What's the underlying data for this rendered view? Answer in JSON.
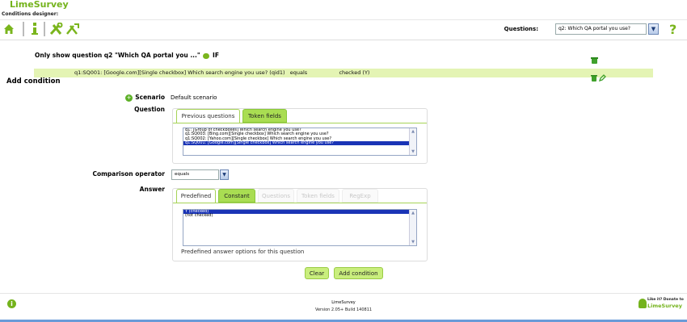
{
  "app": {
    "brand": "LimeSurvey",
    "designer_title": "Conditions designer:"
  },
  "toolbar": {
    "icons": [
      "home-icon",
      "info-icon",
      "tools-icon",
      "conditions-icon"
    ],
    "questions_label": "Questions:",
    "questions_selected": "q2: Which QA portal you use?",
    "help_label": "?"
  },
  "condition": {
    "heading_prefix": "Only show question q2 \"Which QA portal you ...\"",
    "heading_suffix": "IF",
    "row_text": "q1:SQ001: [Google.com][Single checkbox] Which search engine you use? (qid1)   equals                   checked (Y)"
  },
  "add_condition": {
    "title": "Add condition",
    "scenario_label": "Scenario",
    "scenario_value": "Default scenario",
    "question_label": "Question",
    "question_tabs": [
      "Previous questions",
      "Token fields"
    ],
    "question_options": [
      "q1: [Group of checkboxes] Which search engine you use?",
      "q1:SQ003: [Bing.com][Single checkbox] Which search engine you use?",
      "q1:SQ002: [Yahoo.com][Single checkbox] Which search engine you use?",
      "q1:SQ001: [Google.com][Single checkbox] Which search engine you use?"
    ],
    "comparison_label": "Comparison operator",
    "comparison_value": "equals",
    "answer_label": "Answer",
    "answer_tabs": [
      "Predefined",
      "Constant",
      "Questions",
      "Token fields",
      "RegExp"
    ],
    "answer_options": [
      "Y (checked)",
      "(not checked)"
    ],
    "answer_hint": "Predefined answer options for this question",
    "clear_button": "Clear",
    "add_button": "Add condition"
  },
  "footer": {
    "name": "LimeSurvey",
    "version": "Version 2.05+ Build 140811",
    "donate_line1": "Like it? Donate to",
    "donate_line2": "LimeSurvey"
  },
  "colors": {
    "brand_green": "#74b31c",
    "tab_green": "#a9dd52",
    "condition_row": "#e4f4b4",
    "selection_blue": "#1a34b6"
  }
}
